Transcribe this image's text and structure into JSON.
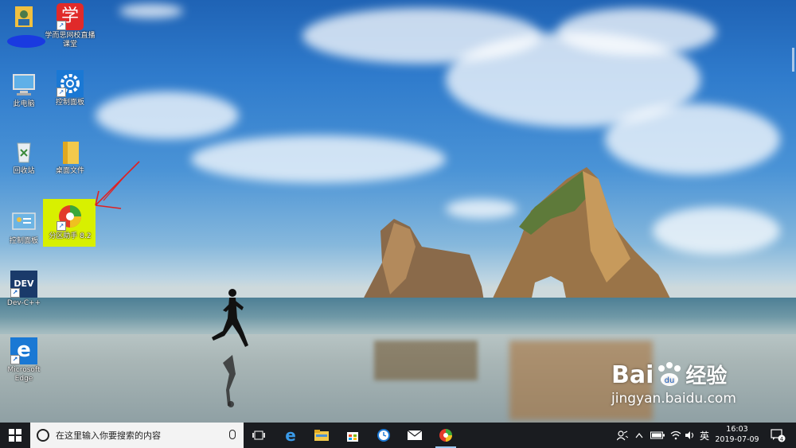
{
  "desktop": {
    "icons": [
      {
        "id": "user",
        "label": "",
        "icon": "user-folder-icon"
      },
      {
        "id": "xueersi",
        "label": "学而思网校直播课堂",
        "icon": "xueersi-icon",
        "glyph": "学"
      },
      {
        "id": "this-pc",
        "label": "此电脑",
        "icon": "computer-icon"
      },
      {
        "id": "settings",
        "label": "控制面板",
        "icon": "gear-icon"
      },
      {
        "id": "recycle",
        "label": "回收站",
        "icon": "recycle-bin-icon"
      },
      {
        "id": "desktop-files",
        "label": "桌面文件",
        "icon": "folder-icon"
      },
      {
        "id": "control-panel",
        "label": "控制面板",
        "icon": "control-panel-icon"
      },
      {
        "id": "partition",
        "label": "分区助手 8.2",
        "icon": "partition-assistant-icon"
      },
      {
        "id": "devcpp",
        "label": "Dev-C++",
        "icon": "devcpp-icon",
        "glyph": "DEV"
      },
      {
        "id": "edge",
        "label": "Microsoft Edge",
        "icon": "edge-icon",
        "glyph": "e"
      }
    ]
  },
  "taskbar": {
    "search_placeholder": "在这里输入你要搜索的内容",
    "apps": [
      "task-view-icon",
      "edge-icon",
      "file-explorer-icon",
      "store-icon",
      "clock-app-icon",
      "mail-icon",
      "partition-assistant-icon"
    ],
    "ime": "英",
    "time": "16:03",
    "date": "2019-07-09",
    "notification_count": "4"
  },
  "watermark": {
    "brand": "Bai",
    "brand2": "经验",
    "url": "jingyan.baidu.com"
  },
  "colors": {
    "taskbar": "#1a1c20",
    "highlight": "#d8f000",
    "arrow": "#e02020"
  }
}
